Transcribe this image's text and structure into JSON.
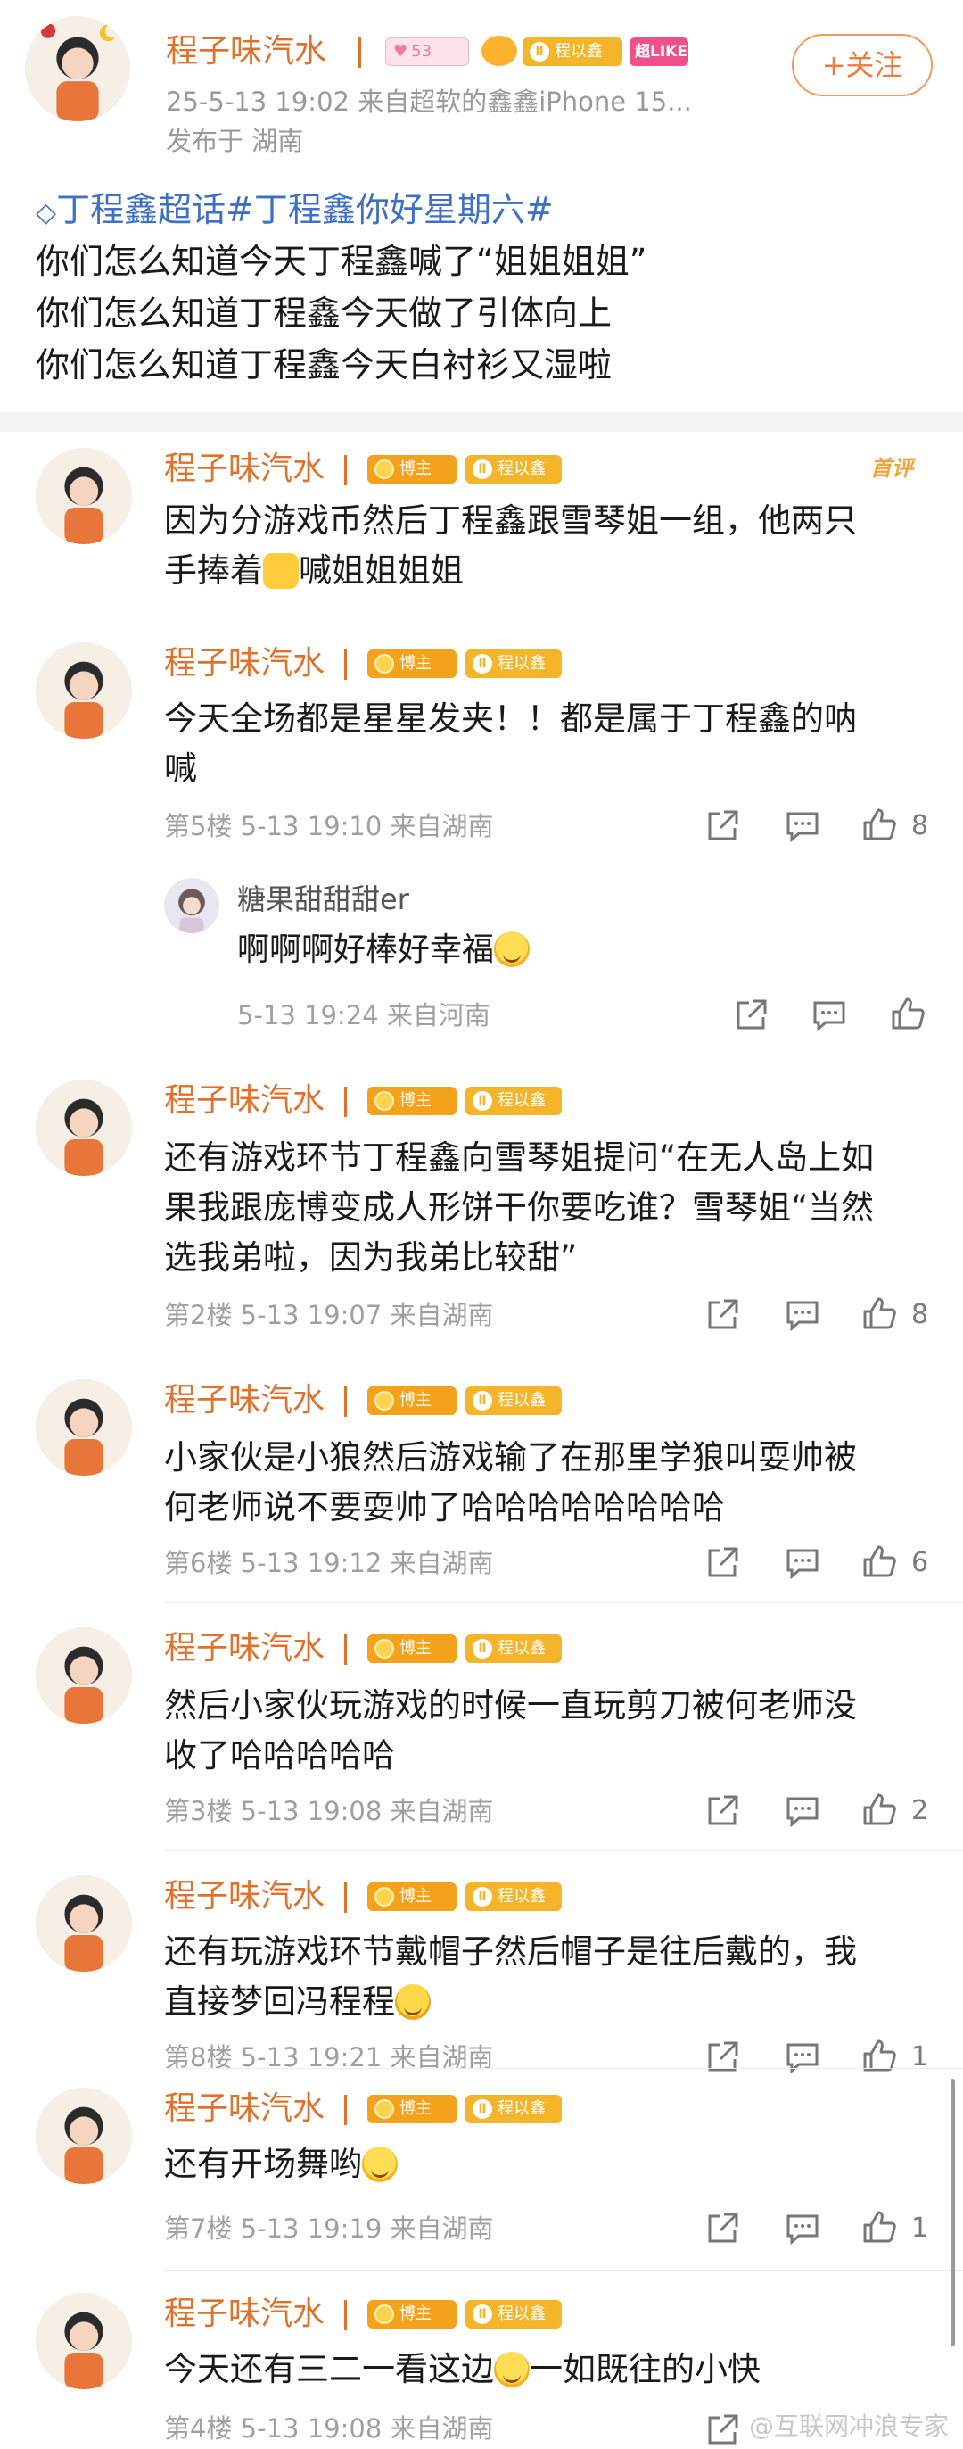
{
  "post": {
    "author": "程子味汽水",
    "fans_badge_level": "53",
    "group_badge": "程以鑫",
    "like_badge": "超LIKE",
    "follow_label": "+关注",
    "time_source": "25-5-13 19:02  来自超软的鑫鑫iPhone 15...",
    "location": "发布于 湖南",
    "topic": "丁程鑫超话#丁程鑫你好星期六#",
    "lines": [
      "你们怎么知道今天丁程鑫喊了“姐姐姐姐”",
      "你们怎么知道丁程鑫今天做了引体向上",
      "你们怎么知道丁程鑫今天白衬衫又湿啦"
    ]
  },
  "badges": {
    "host": "博主",
    "group": "程以鑫"
  },
  "top_pick_label": "首评",
  "comments": [
    {
      "author": "程子味汽水",
      "lines": [
        "因为分游戏币然后丁程鑫跟雪琴姐一组，他两只",
        "手捧着",
        "喊姐姐姐姐"
      ],
      "meta": "",
      "likes": ""
    },
    {
      "author": "程子味汽水",
      "lines": [
        "今天全场都是星星发夹！！都是属于丁程鑫的呐",
        "喊"
      ],
      "meta": "第5楼  5-13 19:10  来自湖南",
      "likes": "8"
    },
    {
      "author": "程子味汽水",
      "lines": [
        "还有游戏环节丁程鑫向雪琴姐提问“在无人岛上如",
        "果我跟庞博变成人形饼干你要吃谁？雪琴姐“当然",
        "选我弟啦，因为我弟比较甜”"
      ],
      "meta": "第2楼  5-13 19:07  来自湖南",
      "likes": "8"
    },
    {
      "author": "程子味汽水",
      "lines": [
        "小家伙是小狼然后游戏输了在那里学狼叫耍帅被",
        "何老师说不要耍帅了哈哈哈哈哈哈哈哈"
      ],
      "meta": "第6楼  5-13 19:12  来自湖南",
      "likes": "6"
    },
    {
      "author": "程子味汽水",
      "lines": [
        "然后小家伙玩游戏的时候一直玩剪刀被何老师没",
        "收了哈哈哈哈哈"
      ],
      "meta": "第3楼  5-13 19:08  来自湖南",
      "likes": "2"
    },
    {
      "author": "程子味汽水",
      "lines": [
        "还有玩游戏环节戴帽子然后帽子是往后戴的，我",
        "直接梦回冯程程"
      ],
      "meta": "第8楼  5-13 19:21  来自湖南",
      "likes": "1"
    },
    {
      "author": "程子味汽水",
      "lines": [
        "还有开场舞哟"
      ],
      "meta": "第7楼  5-13 19:19  来自湖南",
      "likes": "1"
    },
    {
      "author": "程子味汽水",
      "lines": [
        "今天还有三二一看这边",
        "一如既往的小快"
      ],
      "meta": "第4楼  5-13 19:08  来自湖南",
      "likes": ""
    }
  ],
  "reply": {
    "author": "糖果甜甜甜er",
    "text": "啊啊啊好棒好幸福",
    "meta": "5-13 19:24  来自河南"
  },
  "watermark": "@互联网冲浪专家",
  "colors": {
    "accent": "#e0712a",
    "topic": "#3f70c4",
    "meta": "#a0a0a0"
  }
}
